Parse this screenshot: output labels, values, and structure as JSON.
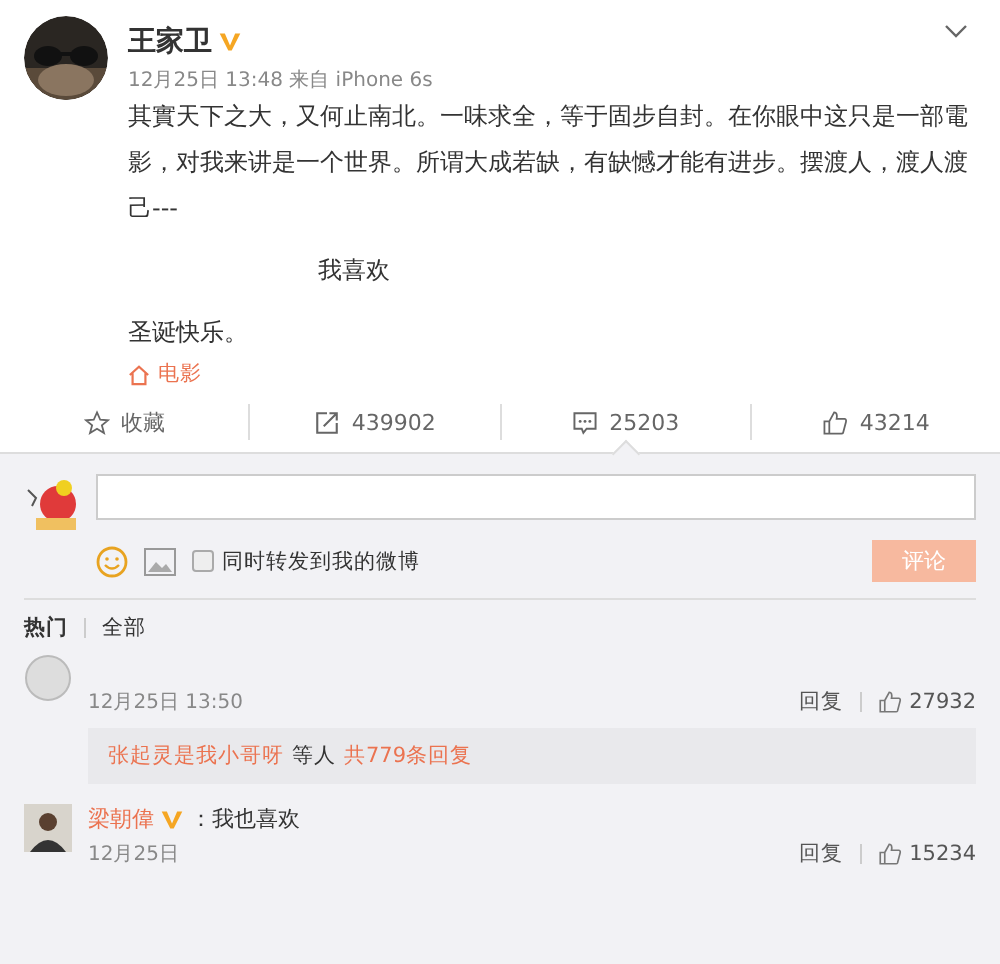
{
  "post": {
    "author": "王家卫",
    "verified": true,
    "meta": "12月25日 13:48 来自 iPhone 6s",
    "paragraphs": [
      {
        "kind": "body",
        "text": "其實天下之大，又何止南北。一味求全，等于固步自封。在你眼中这只是一部電影，对我来讲是一个世界。所谓大成若缺，有缺憾才能有进步。摆渡人，渡人渡己---"
      },
      {
        "kind": "center",
        "text": "我喜欢"
      },
      {
        "kind": "body",
        "text": "圣诞快乐。"
      }
    ],
    "topic": "电影"
  },
  "actions": [
    {
      "kind": "favorite",
      "label": "收藏",
      "selected": false
    },
    {
      "kind": "repost",
      "label": "439902",
      "selected": false
    },
    {
      "kind": "comment",
      "label": "25203",
      "selected": true
    },
    {
      "kind": "like",
      "label": "43214",
      "selected": false
    }
  ],
  "composer": {
    "repost_label": "同时转发到我的微博",
    "repost_checked": false,
    "submit": "评论",
    "submit_disabled": true
  },
  "comment_tabs": [
    {
      "label": "热门",
      "selected": true
    },
    {
      "label": "全部",
      "selected": false
    }
  ],
  "comments": [
    {
      "time": "12月25日 13:50",
      "reply": "回复",
      "likes": "27932",
      "thread": {
        "names": "张起灵是我小哥呀",
        "middle": "等人",
        "total": "共779条回复"
      }
    },
    {
      "author": "梁朝偉",
      "verified": true,
      "text": "：我也喜欢",
      "time": "12月25日",
      "reply": "回复",
      "likes": "15234"
    }
  ]
}
